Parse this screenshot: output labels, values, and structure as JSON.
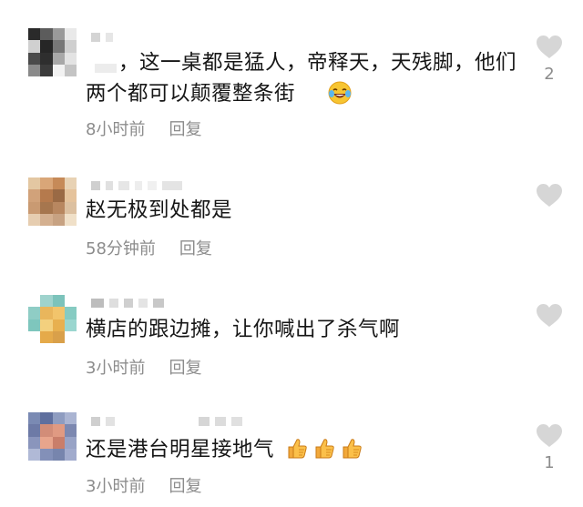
{
  "comments": [
    {
      "text": "，这一桌都是猛人，帝释天，天残脚，他们两个都可以颠覆整条街",
      "emoji": "laughing-crying-emoji",
      "time": "8小时前",
      "reply_label": "回复",
      "likes": "2",
      "avatar_colors": [
        "#2a2a2a",
        "#5c5c5c",
        "#9a9a9a",
        "#e9e9e9",
        "#d0d0d0",
        "#262626",
        "#777777",
        "#cfcfcf",
        "#4a4a4a",
        "#2e2e2e",
        "#a8a8a8",
        "#e3e3e3",
        "#8a8a8a",
        "#3b3b3b",
        "#f2f2f2",
        "#c4c4c4"
      ]
    },
    {
      "text": "赵无极到处都是",
      "emoji": "",
      "time": "58分钟前",
      "reply_label": "回复",
      "likes": "",
      "avatar_colors": [
        "#e3c7a2",
        "#d9a678",
        "#c68a58",
        "#e8d2b4",
        "#d1a27a",
        "#b57a4d",
        "#9a6a45",
        "#e5c39c",
        "#c99a72",
        "#a6764e",
        "#b88760",
        "#dcc0a0",
        "#e6cdb0",
        "#d4b090",
        "#c7a282",
        "#f0e0c8"
      ]
    },
    {
      "text": "横店的跟边摊，让你喊出了杀气啊",
      "emoji": "",
      "time": "3小时前",
      "reply_label": "回复",
      "likes": "",
      "avatar_colors": [
        "#ffffff",
        "#9fd3cd",
        "#7cc3bb",
        "#ffffff",
        "#8fcdc5",
        "#e9b65c",
        "#f2c46b",
        "#86cbc2",
        "#7ec6bd",
        "#f3d07e",
        "#e8b04f",
        "#9ad6cf",
        "#ffffff",
        "#e5aa4a",
        "#d9a04a",
        "#ffffff"
      ]
    },
    {
      "text": "还是港台明星接地气",
      "emoji": "thumbs-up-emoji",
      "emoji_count": 3,
      "time": "3小时前",
      "reply_label": "回复",
      "likes": "1",
      "avatar_colors": [
        "#7a8ab3",
        "#5f6f9e",
        "#8e9cc0",
        "#aab4d2",
        "#6d7aa6",
        "#d28d78",
        "#e09a82",
        "#7c88b0",
        "#8a95bc",
        "#e8a58c",
        "#c97e6a",
        "#98a3c6",
        "#b0b9d6",
        "#8390b8",
        "#7785ad",
        "#a1abcd"
      ]
    }
  ]
}
